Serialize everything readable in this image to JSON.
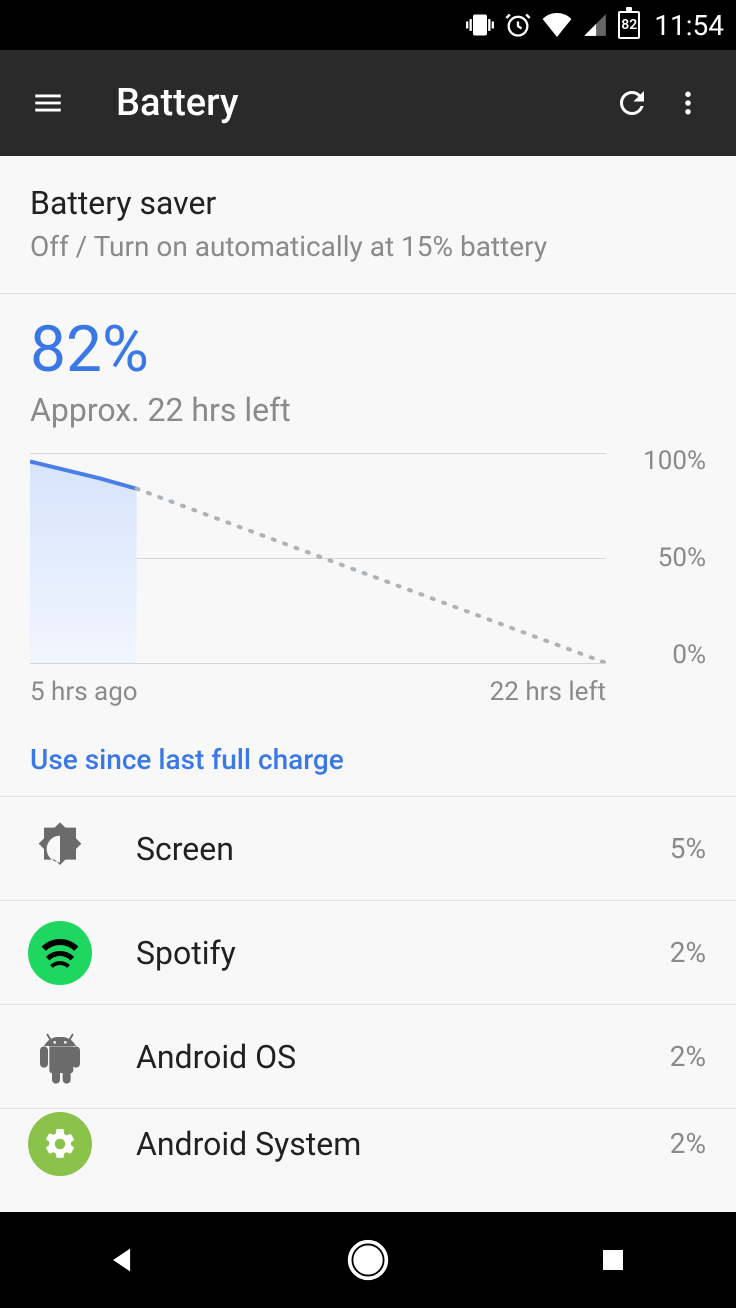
{
  "status": {
    "battery_pct_small": "82",
    "clock": "11:54"
  },
  "appbar": {
    "title": "Battery"
  },
  "saver": {
    "title": "Battery saver",
    "subtitle": "Off / Turn on automatically at 15% battery"
  },
  "battery": {
    "percent_label": "82%",
    "approx_label": "Approx. 22 hrs left"
  },
  "chart_data": {
    "type": "line",
    "y_ticks": [
      "100%",
      "50%",
      "0%"
    ],
    "x_left": "5 hrs ago",
    "x_right": "22 hrs left",
    "ylim": [
      0,
      100
    ],
    "history": {
      "x": [
        0,
        0.06,
        0.12,
        0.185
      ],
      "y": [
        96,
        92,
        88,
        83
      ]
    },
    "projection": {
      "x": [
        0.185,
        1.0
      ],
      "y": [
        83,
        0
      ]
    }
  },
  "section_header": "Use since last full charge",
  "usage": [
    {
      "icon": "brightness",
      "name": "Screen",
      "pct": "5%"
    },
    {
      "icon": "spotify",
      "name": "Spotify",
      "pct": "2%"
    },
    {
      "icon": "android",
      "name": "Android OS",
      "pct": "2%"
    },
    {
      "icon": "gear",
      "name": "Android System",
      "pct": "2%"
    }
  ]
}
